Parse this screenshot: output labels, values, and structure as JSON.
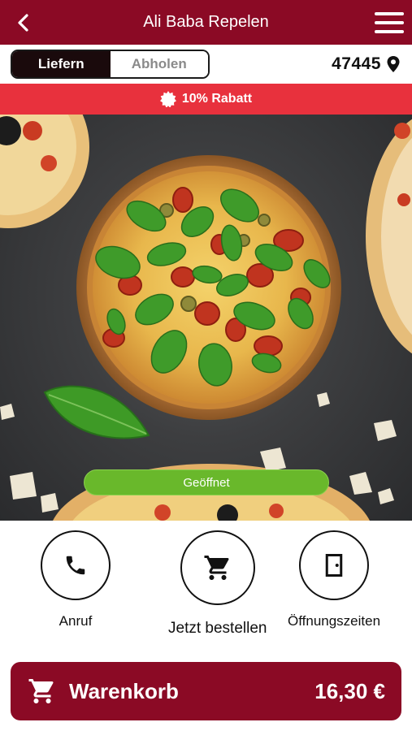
{
  "header": {
    "title": "Ali Baba Repelen",
    "back_icon": "chevron-left-icon",
    "menu_icon": "hamburger-menu-icon"
  },
  "mode_toggle": {
    "options": [
      {
        "label": "Liefern",
        "active": true
      },
      {
        "label": "Abholen",
        "active": false
      }
    ]
  },
  "location": {
    "postal_code": "47445",
    "icon": "location-pin-icon"
  },
  "promo": {
    "text": "10% Rabatt",
    "icon": "discount-badge-icon"
  },
  "hero": {
    "status": "Geöffnet"
  },
  "actions": [
    {
      "label": "Anruf",
      "icon": "phone-icon"
    },
    {
      "label": "Jetzt bestellen",
      "icon": "cart-icon"
    },
    {
      "label": "Öffnungszeiten",
      "icon": "door-icon"
    }
  ],
  "cart": {
    "label": "Warenkorb",
    "total": "16,30 €",
    "icon": "cart-icon"
  },
  "colors": {
    "brand": "#8b0a25",
    "promo": "#e8313d",
    "open": "#69b82b"
  }
}
